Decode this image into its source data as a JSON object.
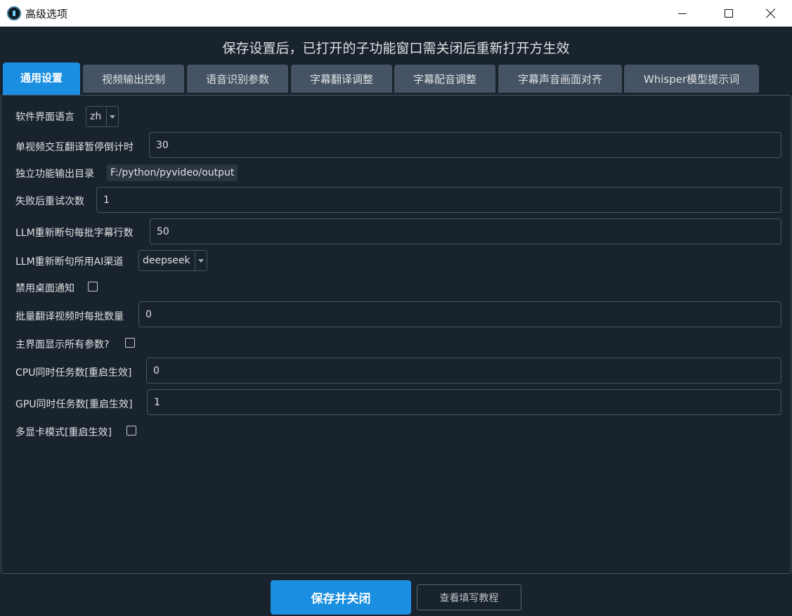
{
  "window": {
    "title": "高级选项",
    "minimize": "minimize",
    "maximize": "maximize",
    "close": "close"
  },
  "notice": "保存设置后，已打开的子功能窗口需关闭后重新打开方生效",
  "tabs": [
    {
      "label": "通用设置",
      "active": true
    },
    {
      "label": "视频输出控制",
      "active": false
    },
    {
      "label": "语音识别参数",
      "active": false
    },
    {
      "label": "字幕翻译调整",
      "active": false
    },
    {
      "label": "字幕配音调整",
      "active": false
    },
    {
      "label": "字幕声音画面对齐",
      "active": false
    },
    {
      "label": "Whisper模型提示词",
      "active": false
    }
  ],
  "settings": {
    "ui_language": {
      "label": "软件界面语言",
      "value": "zh"
    },
    "pause_countdown": {
      "label": "单视频交互翻译暂停倒计时",
      "value": "30"
    },
    "output_dir": {
      "label": "独立功能输出目录",
      "value": "F:/python/pyvideo/output"
    },
    "retry_count": {
      "label": "失败后重试次数",
      "value": "1"
    },
    "llm_batch_lines": {
      "label": "LLM重新断句每批字幕行数",
      "value": "50"
    },
    "llm_channel": {
      "label": "LLM重新断句所用AI渠道",
      "value": "deepseek"
    },
    "disable_notify": {
      "label": "禁用桌面通知",
      "checked": false
    },
    "batch_count": {
      "label": "批量翻译视频时每批数量",
      "value": "0"
    },
    "show_all_params": {
      "label": "主界面显示所有参数?",
      "checked": false
    },
    "cpu_tasks": {
      "label": "CPU同时任务数[重启生效]",
      "value": "0"
    },
    "gpu_tasks": {
      "label": "GPU同时任务数[重启生效]",
      "value": "1"
    },
    "multi_gpu": {
      "label": "多显卡模式[重启生效]",
      "checked": false
    }
  },
  "buttons": {
    "save": "保存并关闭",
    "help": "查看填写教程"
  },
  "colors": {
    "background": "#19232d",
    "accent": "#1a8ee0",
    "tab_inactive": "#455364",
    "border": "#455364"
  }
}
